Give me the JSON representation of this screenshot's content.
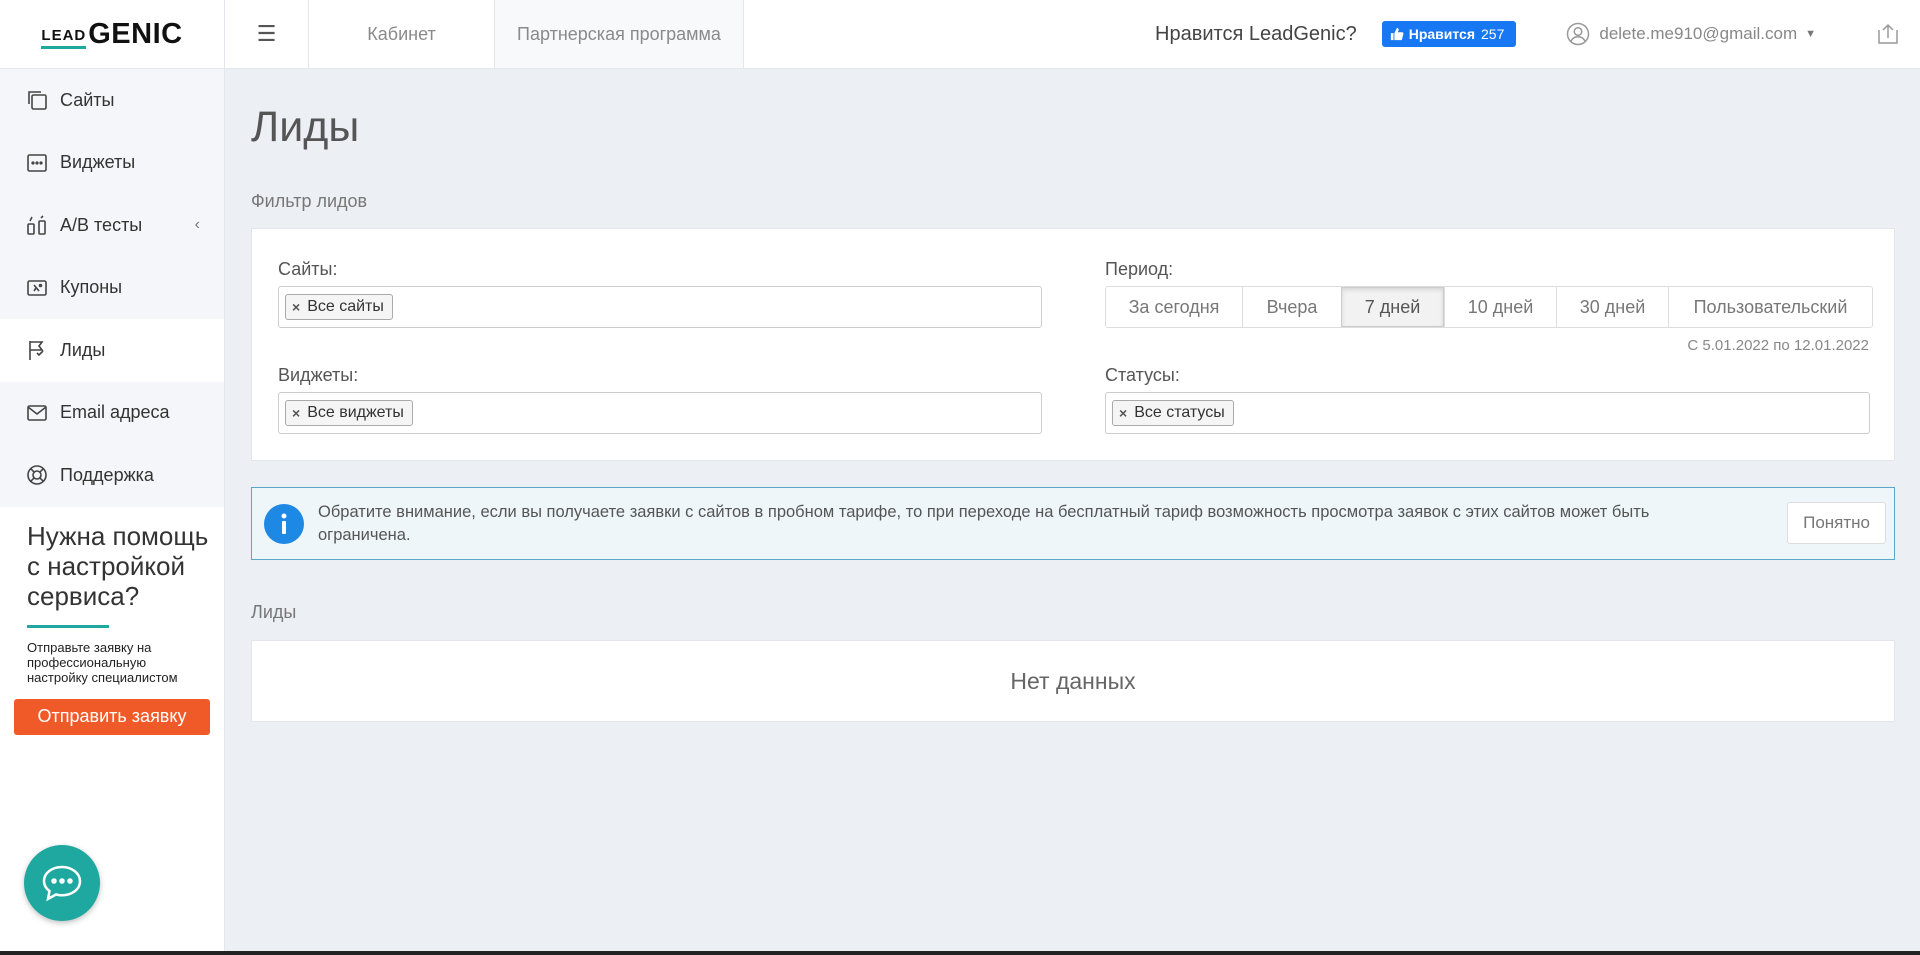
{
  "header": {
    "logo_lead": "LEAD",
    "logo_genic": "GENIC",
    "tabs": [
      {
        "label": "Кабинет"
      },
      {
        "label": "Партнерская программа"
      }
    ],
    "like_question": "Нравится LeadGenic?",
    "fb_like_label": "Нравится",
    "fb_like_count": "257",
    "user_email": "delete.me910@gmail.com"
  },
  "sidebar": {
    "items": [
      {
        "label": "Сайты",
        "icon": "sites-icon"
      },
      {
        "label": "Виджеты",
        "icon": "widgets-icon"
      },
      {
        "label": "A/B тесты",
        "icon": "ab-tests-icon"
      },
      {
        "label": "Купоны",
        "icon": "coupons-icon"
      },
      {
        "label": "Лиды",
        "icon": "leads-flag-icon"
      },
      {
        "label": "Email адреса",
        "icon": "envelope-icon"
      },
      {
        "label": "Поддержка",
        "icon": "lifebuoy-icon"
      }
    ],
    "active_item": "Лиды",
    "help_title": "Нужна помощь с настройкой сервиса?",
    "help_text": "Отправьте заявку на профессиональную настройку специалистом",
    "send_button": "Отправить заявку"
  },
  "main": {
    "page_title": "Лиды",
    "filter_title": "Фильтр лидов",
    "sites_label": "Сайты:",
    "sites_tag": "Все сайты",
    "widgets_label": "Виджеты:",
    "widgets_tag": "Все виджеты",
    "period_label": "Период:",
    "period_options": [
      "За сегодня",
      "Вчера",
      "7 дней",
      "10 дней",
      "30 дней",
      "Пользовательский"
    ],
    "period_selected": "7 дней",
    "date_range": "С 5.01.2022 по 12.01.2022",
    "statuses_label": "Статусы:",
    "statuses_tag": "Все статусы",
    "notice_text": "Обратите внимание, если вы получаете заявки с сайтов в пробном тарифе, то при переходе на бесплатный тариф возможность просмотра заявок с этих сайтов может быть ограничена.",
    "notice_ok": "Понятно",
    "leads_title": "Лиды",
    "no_data": "Нет данных"
  },
  "colors": {
    "accent": "#1fa8a0",
    "orange": "#f05a28",
    "facebook": "#1877f2",
    "info": "#1e88e5",
    "background": "#ecf0f5"
  }
}
